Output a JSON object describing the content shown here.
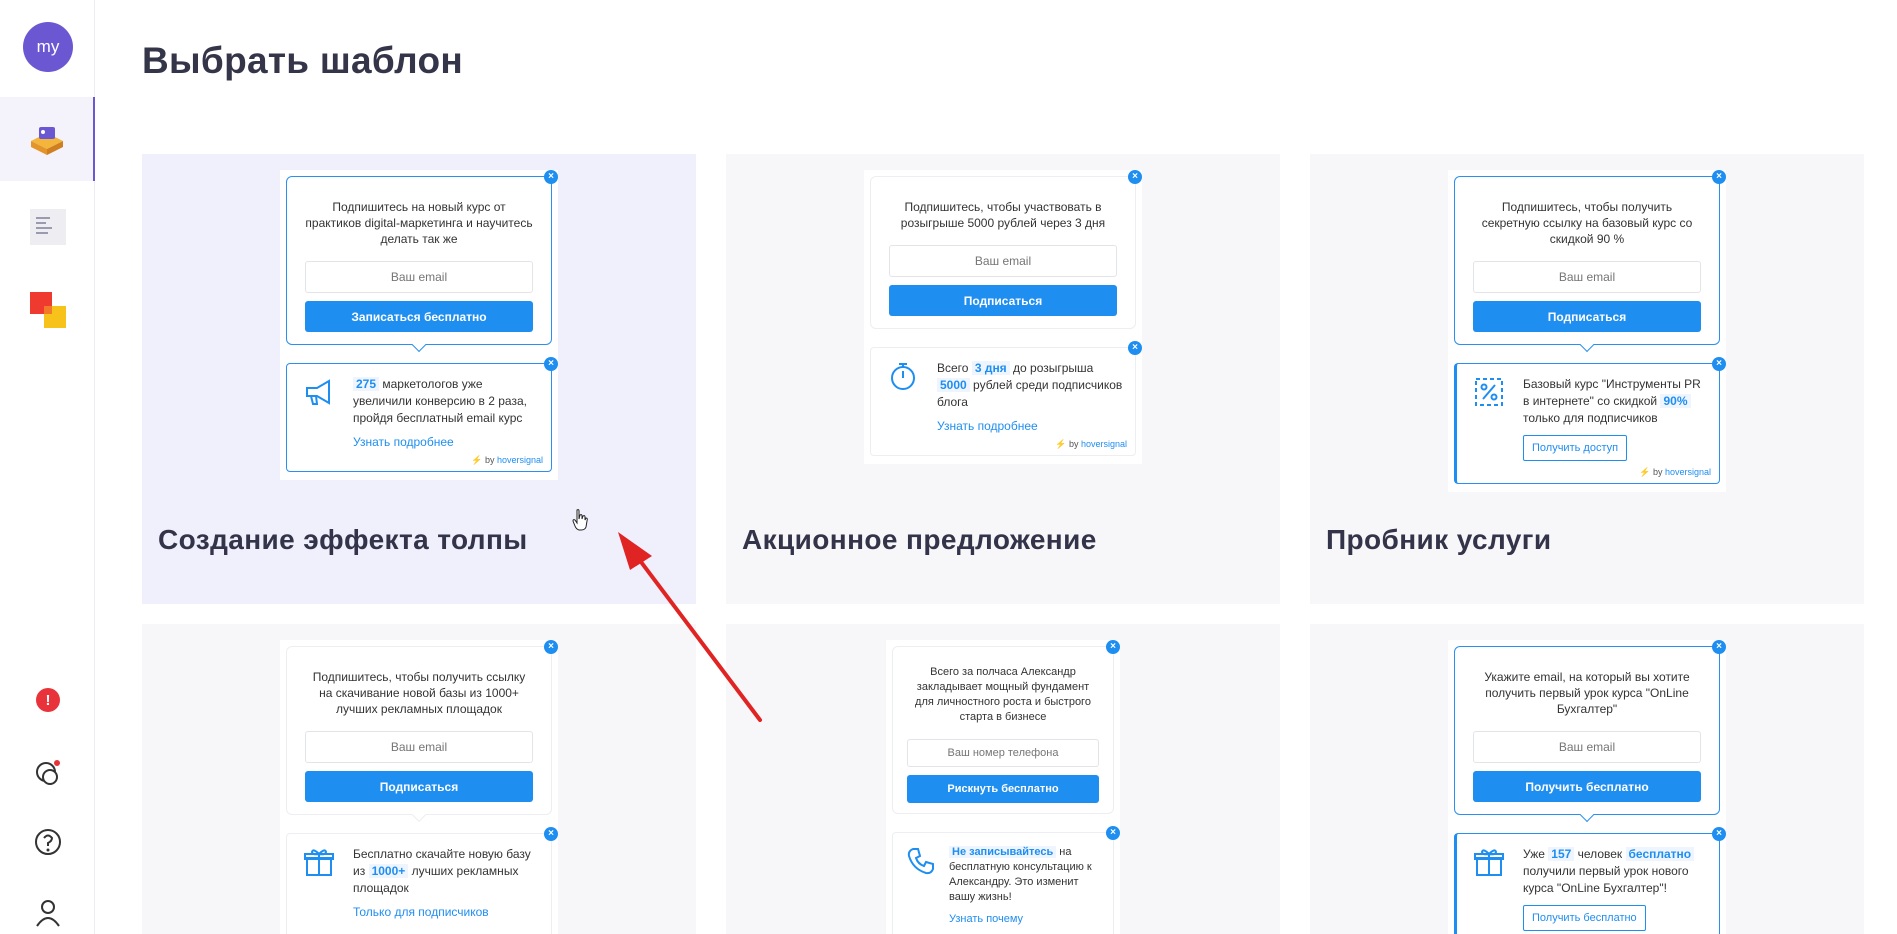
{
  "sidebar": {
    "avatar_text": "my"
  },
  "page": {
    "title": "Выбрать шаблон"
  },
  "cards": [
    {
      "title": "Создание эффекта толпы",
      "widget_text": "Подпишитесь на новый курс от практиков digital-маркетинга и научитесь делать так же",
      "input_placeholder": "Ваш email",
      "button": "Записаться бесплатно",
      "notice_num": "275",
      "notice_text": "маркетологов уже увеличили конверсию в 2 раза, пройдя бесплатный email курс",
      "notice_link": "Узнать подробнее",
      "brand_by": "by",
      "brand_name": "hoversignal"
    },
    {
      "title": "Акционное предложение",
      "widget_text": "Подпишитесь, чтобы участвовать в розыгрыше 5000 рублей через 3 дня",
      "input_placeholder": "Ваш email",
      "button": "Подписаться",
      "notice_pre": "Всего",
      "notice_hl1": "3 дня",
      "notice_mid": "до розыгрыша",
      "notice_hl2": "5000",
      "notice_post": "рублей среди подписчиков блога",
      "notice_link": "Узнать подробнее",
      "brand_by": "by",
      "brand_name": "hoversignal"
    },
    {
      "title": "Пробник услуги",
      "widget_text": "Подпишитесь, чтобы получить секретную ссылку на базовый курс со скидкой 90 %",
      "input_placeholder": "Ваш email",
      "button": "Подписаться",
      "notice_pre": "Базовый курс \"Инструменты PR в интернете\" со скидкой",
      "notice_hl": "90%",
      "notice_post": "только для подписчиков",
      "notice_button": "Получить доступ",
      "brand_by": "by",
      "brand_name": "hoversignal"
    },
    {
      "widget_text": "Подпишитесь, чтобы получить ссылку на скачивание новой базы из 1000+ лучших рекламных площадок",
      "input_placeholder": "Ваш email",
      "button": "Подписаться",
      "notice_pre": "Бесплатно скачайте новую базу из",
      "notice_hl": "1000+",
      "notice_post": "лучших рекламных площадок",
      "notice_link": "Только для подписчиков"
    },
    {
      "widget_text": "Всего за полчаса Александр закладывает мощный фундамент для личностного роста и быстрого старта в бизнесе",
      "input_placeholder": "Ваш номер телефона",
      "button": "Рискнуть бесплатно",
      "notice_hl": "Не записывайтесь",
      "notice_post": "на бесплатную консультацию к Александру. Это изменит вашу жизнь!",
      "notice_link": "Узнать почему"
    },
    {
      "widget_text": "Укажите email, на который вы хотите получить первый урок курса \"OnLine Бухгалтер\"",
      "input_placeholder": "Ваш email",
      "button": "Получить бесплатно",
      "notice_pre": "Уже",
      "notice_hl1": "157",
      "notice_mid": "человек",
      "notice_hl2": "бесплатно",
      "notice_post": "получили первый урок нового курса \"OnLine Бухгалтер\"!",
      "notice_button": "Получить бесплатно"
    }
  ],
  "close_glyph": "×",
  "alert_glyph": "!",
  "colors": {
    "accent": "#1f8ef1",
    "avatar": "#6b57d2",
    "selected_card": "#f0effc",
    "card": "#f7f7f9",
    "arrow": "#e02424"
  },
  "icons": [
    "templates-icon",
    "document-icon",
    "squares-icon",
    "alert-icon",
    "chat-icon",
    "help-icon",
    "user-icon",
    "megaphone-icon",
    "stopwatch-icon",
    "percent-icon",
    "gift-icon",
    "phone-icon",
    "cursor-icon",
    "red-arrow-icon"
  ]
}
